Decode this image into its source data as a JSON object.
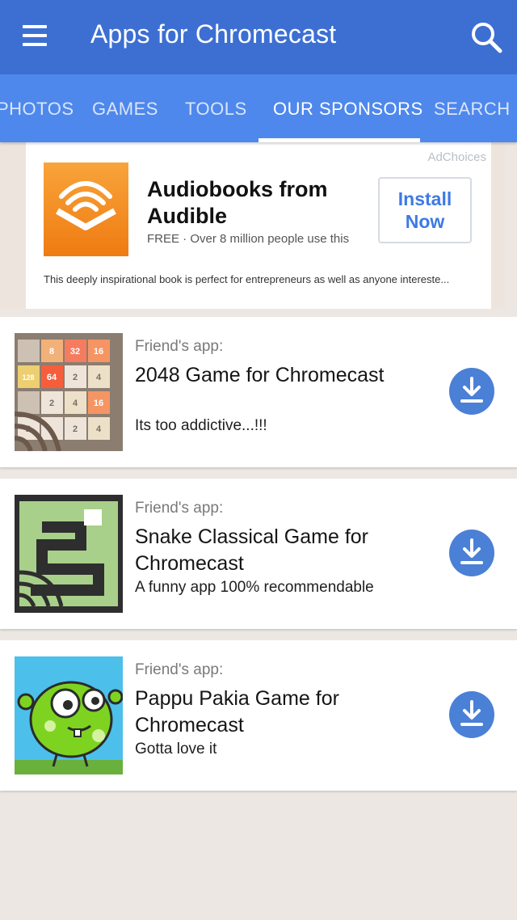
{
  "header": {
    "title": "Apps for Chromecast"
  },
  "tabs": [
    {
      "label": "PHOTOS",
      "active": false
    },
    {
      "label": "GAMES",
      "active": false
    },
    {
      "label": "TOOLS",
      "active": false
    },
    {
      "label": "OUR SPONSORS",
      "active": true
    },
    {
      "label": "SEARCH",
      "active": false
    }
  ],
  "ad": {
    "adchoices": "AdChoices",
    "title": "Audiobooks from Audible",
    "subtitle": "FREE · Over 8 million people use this",
    "button": "Install\nNow",
    "description": "This deeply inspirational book is perfect for entrepreneurs as well as anyone intereste..."
  },
  "apps": [
    {
      "friend": "Friend's app:",
      "name": "2048 Game for Chromecast",
      "desc": "Its too addictive...!!!",
      "icon": "2048-game-icon"
    },
    {
      "friend": "Friend's app:",
      "name": "Snake Classical Game for Chromecast",
      "desc": "A funny app 100% recommendable",
      "icon": "snake-game-icon"
    },
    {
      "friend": "Friend's app:",
      "name": "Pappu Pakia Game for Chromecast",
      "desc": "Gotta love it",
      "icon": "pappu-pakia-icon"
    }
  ],
  "thumb_2048": {
    "tiles": [
      "8",
      "32",
      "16",
      "128",
      "64",
      "2",
      "4",
      "2",
      "4",
      "16",
      "2",
      "2",
      "4"
    ]
  },
  "colors": {
    "appbar": "#3d6fd3",
    "tabbar": "#4e88ec",
    "accent": "#3d7ae4",
    "download": "#4a80d6"
  }
}
